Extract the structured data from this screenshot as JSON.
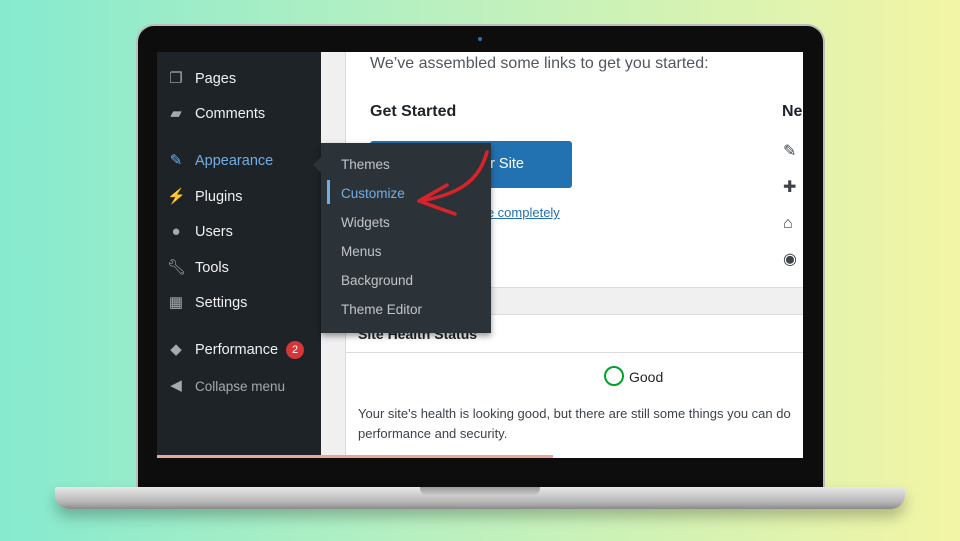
{
  "sidebar": {
    "items": [
      {
        "label": "Pages",
        "icon": "pages-icon"
      },
      {
        "label": "Comments",
        "icon": "comment-icon"
      },
      {
        "label": "Appearance",
        "icon": "brush-icon",
        "active": true
      },
      {
        "label": "Plugins",
        "icon": "plugin-icon"
      },
      {
        "label": "Users",
        "icon": "user-icon"
      },
      {
        "label": "Tools",
        "icon": "wrench-icon"
      },
      {
        "label": "Settings",
        "icon": "settings-icon"
      },
      {
        "label": "Performance",
        "icon": "performance-icon",
        "badge": "2"
      },
      {
        "label": "Collapse menu",
        "icon": "collapse-icon"
      }
    ]
  },
  "flyout": {
    "items": [
      "Themes",
      "Customize",
      "Widgets",
      "Menus",
      "Background",
      "Theme Editor"
    ],
    "current": "Customize"
  },
  "welcome": {
    "intro": "We’ve assembled some links to get you started:",
    "get_started": "Get Started",
    "button": "ur Site",
    "link": "me completely",
    "next_steps": "Ne"
  },
  "site_health": {
    "title": "Site Health Status",
    "status": "Good",
    "text": "Your site's health is looking good, but there are still some things you can do",
    "text2": "performance and security."
  },
  "colors": {
    "sidebar": "#1d2327",
    "accent": "#72aee6",
    "button": "#2271b1",
    "arrow": "#d9232b",
    "good": "#00a32a"
  }
}
